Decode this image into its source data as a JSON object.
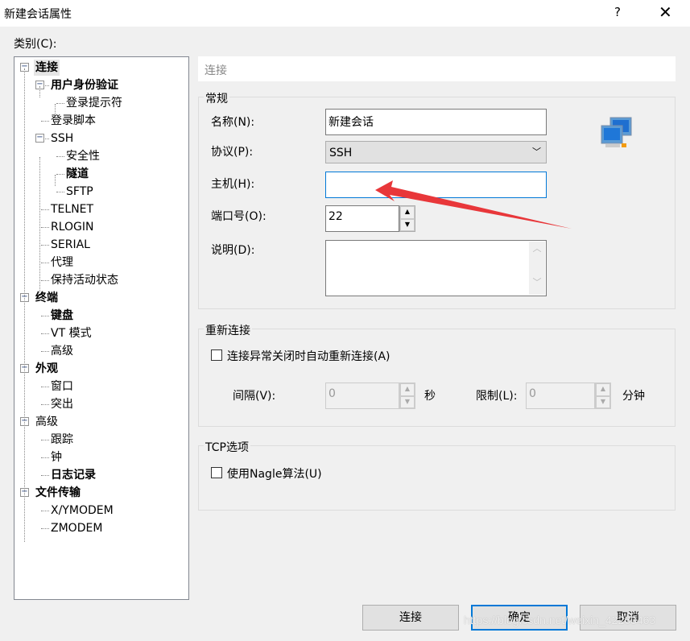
{
  "window": {
    "title": "新建会话属性",
    "help": "?",
    "close": "✕"
  },
  "category_label": "类别(C):",
  "tree": [
    {
      "label": "连接",
      "level": 0,
      "bold": true,
      "expander": true,
      "selected": true
    },
    {
      "label": "用户身份验证",
      "level": 1,
      "bold": true,
      "expander": true
    },
    {
      "label": "登录提示符",
      "level": 2
    },
    {
      "label": "登录脚本",
      "level": 1
    },
    {
      "label": "SSH",
      "level": 1,
      "expander": true
    },
    {
      "label": "安全性",
      "level": 2
    },
    {
      "label": "隧道",
      "level": 2,
      "bold": true
    },
    {
      "label": "SFTP",
      "level": 2
    },
    {
      "label": "TELNET",
      "level": 1
    },
    {
      "label": "RLOGIN",
      "level": 1
    },
    {
      "label": "SERIAL",
      "level": 1
    },
    {
      "label": "代理",
      "level": 1
    },
    {
      "label": "保持活动状态",
      "level": 1
    },
    {
      "label": "终端",
      "level": 0,
      "bold": true,
      "expander": true
    },
    {
      "label": "键盘",
      "level": 1,
      "bold": true
    },
    {
      "label": "VT 模式",
      "level": 1
    },
    {
      "label": "高级",
      "level": 1
    },
    {
      "label": "外观",
      "level": 0,
      "bold": true,
      "expander": true
    },
    {
      "label": "窗口",
      "level": 1
    },
    {
      "label": "突出",
      "level": 1
    },
    {
      "label": "高级",
      "level": 0,
      "expander": true
    },
    {
      "label": "跟踪",
      "level": 1
    },
    {
      "label": "钟",
      "level": 1
    },
    {
      "label": "日志记录",
      "level": 1,
      "bold": true
    },
    {
      "label": "文件传输",
      "level": 0,
      "bold": true,
      "expander": true
    },
    {
      "label": "X/YMODEM",
      "level": 1
    },
    {
      "label": "ZMODEM",
      "level": 1
    }
  ],
  "panel": {
    "header": "连接"
  },
  "general": {
    "title": "常规",
    "name_label": "名称(N):",
    "name_value": "新建会话",
    "protocol_label": "协议(P):",
    "protocol_value": "SSH",
    "host_label": "主机(H):",
    "host_value": "",
    "port_label": "端口号(O):",
    "port_value": "22",
    "desc_label": "说明(D):",
    "desc_value": ""
  },
  "reconnect": {
    "title": "重新连接",
    "checkbox_label": "连接异常关闭时自动重新连接(A)",
    "checked": false,
    "interval_label": "间隔(V):",
    "interval_value": "0",
    "interval_unit": "秒",
    "limit_label": "限制(L):",
    "limit_value": "0",
    "limit_unit": "分钟"
  },
  "tcp": {
    "title": "TCP选项",
    "nagle_label": "使用Nagle算法(U)",
    "checked": false
  },
  "buttons": {
    "connect": "连接",
    "ok": "确定",
    "cancel": "取消"
  },
  "watermark": "https://blog.csdn.net/weixin_42263463",
  "colors": {
    "accent": "#0078d7",
    "arrow": "#e8373a"
  }
}
